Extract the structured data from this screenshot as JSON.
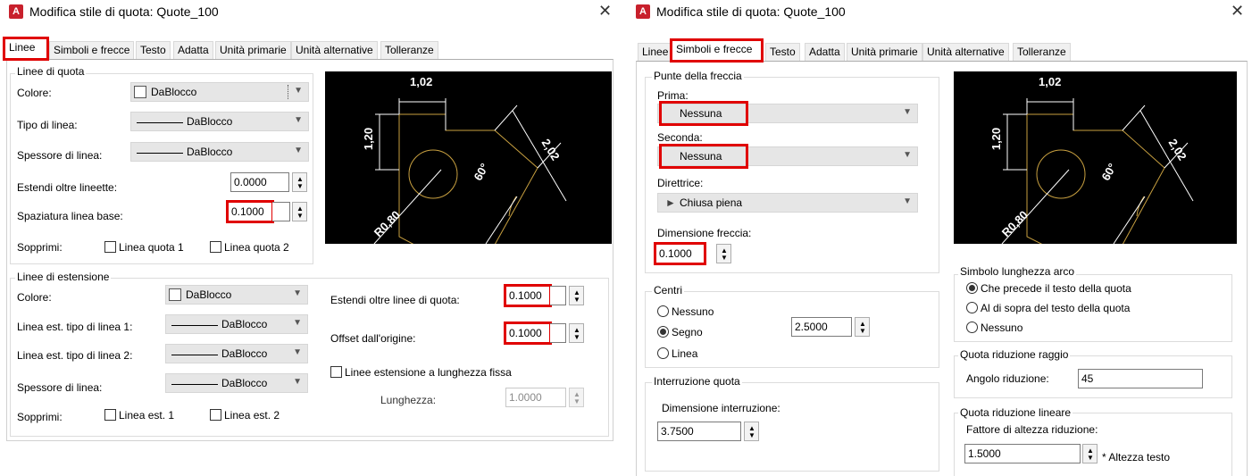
{
  "left": {
    "title": "Modifica stile di quota: Quote_100",
    "tabs": [
      "Linee",
      "Simboli e frecce",
      "Testo",
      "Adatta",
      "Unità primarie",
      "Unità alternative",
      "Tolleranze"
    ],
    "dim_lines": {
      "group": "Linee di quota",
      "color_label": "Colore:",
      "color_value": "DaBlocco",
      "linetype_label": "Tipo di linea:",
      "linetype_value": "DaBlocco",
      "lineweight_label": "Spessore di linea:",
      "lineweight_value": "DaBlocco",
      "extend_label": "Estendi oltre lineette:",
      "extend_value": "0.0000",
      "baseline_label": "Spaziatura linea base:",
      "baseline_value": "0.1000",
      "suppress_label": "Sopprimi:",
      "suppress_1": "Linea quota 1",
      "suppress_2": "Linea quota 2"
    },
    "ext_lines": {
      "group": "Linee di estensione",
      "color_label": "Colore:",
      "color_value": "DaBlocco",
      "lt1_label": "Linea est. tipo di linea 1:",
      "lt1_value": "DaBlocco",
      "lt2_label": "Linea est. tipo di linea 2:",
      "lt2_value": "DaBlocco",
      "lineweight_label": "Spessore di linea:",
      "lineweight_value": "DaBlocco",
      "suppress_label": "Sopprimi:",
      "suppress_1": "Linea est. 1",
      "suppress_2": "Linea est. 2",
      "extend_beyond_label": "Estendi oltre linee di quota:",
      "extend_beyond_value": "0.1000",
      "offset_label": "Offset dall'origine:",
      "offset_value": "0.1000",
      "fixed_length_label": "Linee estensione a lunghezza fissa",
      "length_label": "Lunghezza:",
      "length_value": "1.0000"
    }
  },
  "right": {
    "title": "Modifica stile di quota: Quote_100",
    "tabs": [
      "Linee",
      "Simboli e frecce",
      "Testo",
      "Adatta",
      "Unità primarie",
      "Unità alternative",
      "Tolleranze"
    ],
    "arrows": {
      "group": "Punte della freccia",
      "first_label": "Prima:",
      "first_value": "Nessuna",
      "second_label": "Seconda:",
      "second_value": "Nessuna",
      "leader_label": "Direttrice:",
      "leader_value": "Chiusa piena",
      "size_label": "Dimensione freccia:",
      "size_value": "0.1000"
    },
    "centers": {
      "group": "Centri",
      "none": "Nessuno",
      "mark": "Segno",
      "line": "Linea",
      "value": "2.5000"
    },
    "break": {
      "group": "Interruzione quota",
      "size_label": "Dimensione interruzione:",
      "size_value": "3.7500"
    },
    "arc": {
      "group": "Simbolo lunghezza arco",
      "opt1": "Che precede il testo della quota",
      "opt2": "Al di sopra del testo della quota",
      "opt3": "Nessuno"
    },
    "radius_jog": {
      "group": "Quota riduzione raggio",
      "angle_label": "Angolo riduzione:",
      "angle_value": "45"
    },
    "linear_jog": {
      "group": "Quota riduzione lineare",
      "factor_label": "Fattore di altezza riduzione:",
      "factor_value": "1.5000",
      "suffix": "* Altezza testo"
    }
  },
  "preview": {
    "top_dim": "1,02",
    "left_dim": "1,20",
    "diag_dim": "2,02",
    "angle": "60°",
    "radius": "R0,80"
  },
  "colors": {
    "highlight": "#e00000",
    "preview_bg": "#000000",
    "preview_lines": "#c8a040"
  }
}
